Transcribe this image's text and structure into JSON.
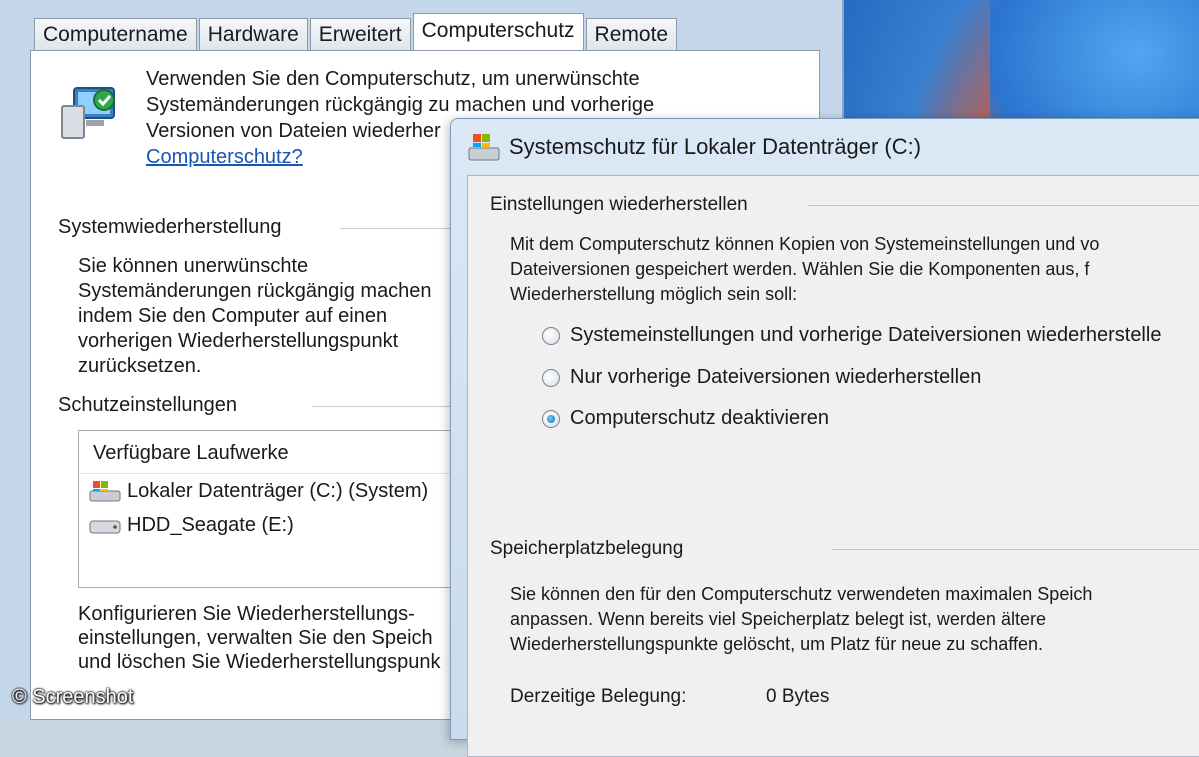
{
  "back_window": {
    "tabs": [
      {
        "label": "Computername"
      },
      {
        "label": "Hardware"
      },
      {
        "label": "Erweitert"
      },
      {
        "label": "Computerschutz"
      },
      {
        "label": "Remote"
      }
    ],
    "intro_lines": [
      "Verwenden Sie den Computerschutz, um unerwünschte",
      "Systemänderungen rückgängig zu machen und vorherige",
      "Versionen von Dateien wiederher"
    ],
    "intro_link": "Computerschutz?",
    "restore_section_title": "Systemwiederherstellung",
    "restore_text_lines": [
      "Sie können unerwünschte",
      "Systemänderungen rückgängig machen",
      "indem Sie den Computer auf einen",
      "vorherigen Wiederherstellungspunkt",
      "zurücksetzen."
    ],
    "protection_section_title": "Schutzeinstellungen",
    "drives_header": "Verfügbare Laufwerke",
    "drives": [
      {
        "label": "Lokaler Datenträger (C:) (System)",
        "icon": "system-drive-icon"
      },
      {
        "label": "HDD_Seagate (E:)",
        "icon": "hard-drive-icon"
      }
    ],
    "configure_text_lines": [
      "Konfigurieren Sie Wiederherstellungs-",
      "einstellungen, verwalten Sie den Speich",
      "und löschen Sie Wiederherstellungspunk"
    ]
  },
  "dialog": {
    "title": "Systemschutz für Lokaler Datenträger (C:)",
    "restore_settings_title": "Einstellungen wiederherstellen",
    "restore_settings_lines": [
      "Mit dem Computerschutz können Kopien von Systemeinstellungen und vo",
      "Dateiversionen gespeichert werden. Wählen Sie die Komponenten aus, f",
      "Wiederherstellung möglich sein soll:"
    ],
    "options": [
      {
        "label": "Systemeinstellungen und vorherige Dateiversionen wiederherstelle",
        "checked": false
      },
      {
        "label": "Nur vorherige Dateiversionen wiederherstellen",
        "checked": false
      },
      {
        "label": "Computerschutz deaktivieren",
        "checked": true
      }
    ],
    "disk_usage_title": "Speicherplatzbelegung",
    "disk_usage_lines": [
      "Sie können den für den Computerschutz verwendeten maximalen Speich",
      "anpassen. Wenn bereits viel Speicherplatz belegt ist, werden ältere",
      "Wiederherstellungspunkte gelöscht, um Platz für neue zu schaffen."
    ],
    "current_usage_label": "Derzeitige Belegung:",
    "current_usage_value": "0 Bytes"
  },
  "watermark": "© Screenshot"
}
